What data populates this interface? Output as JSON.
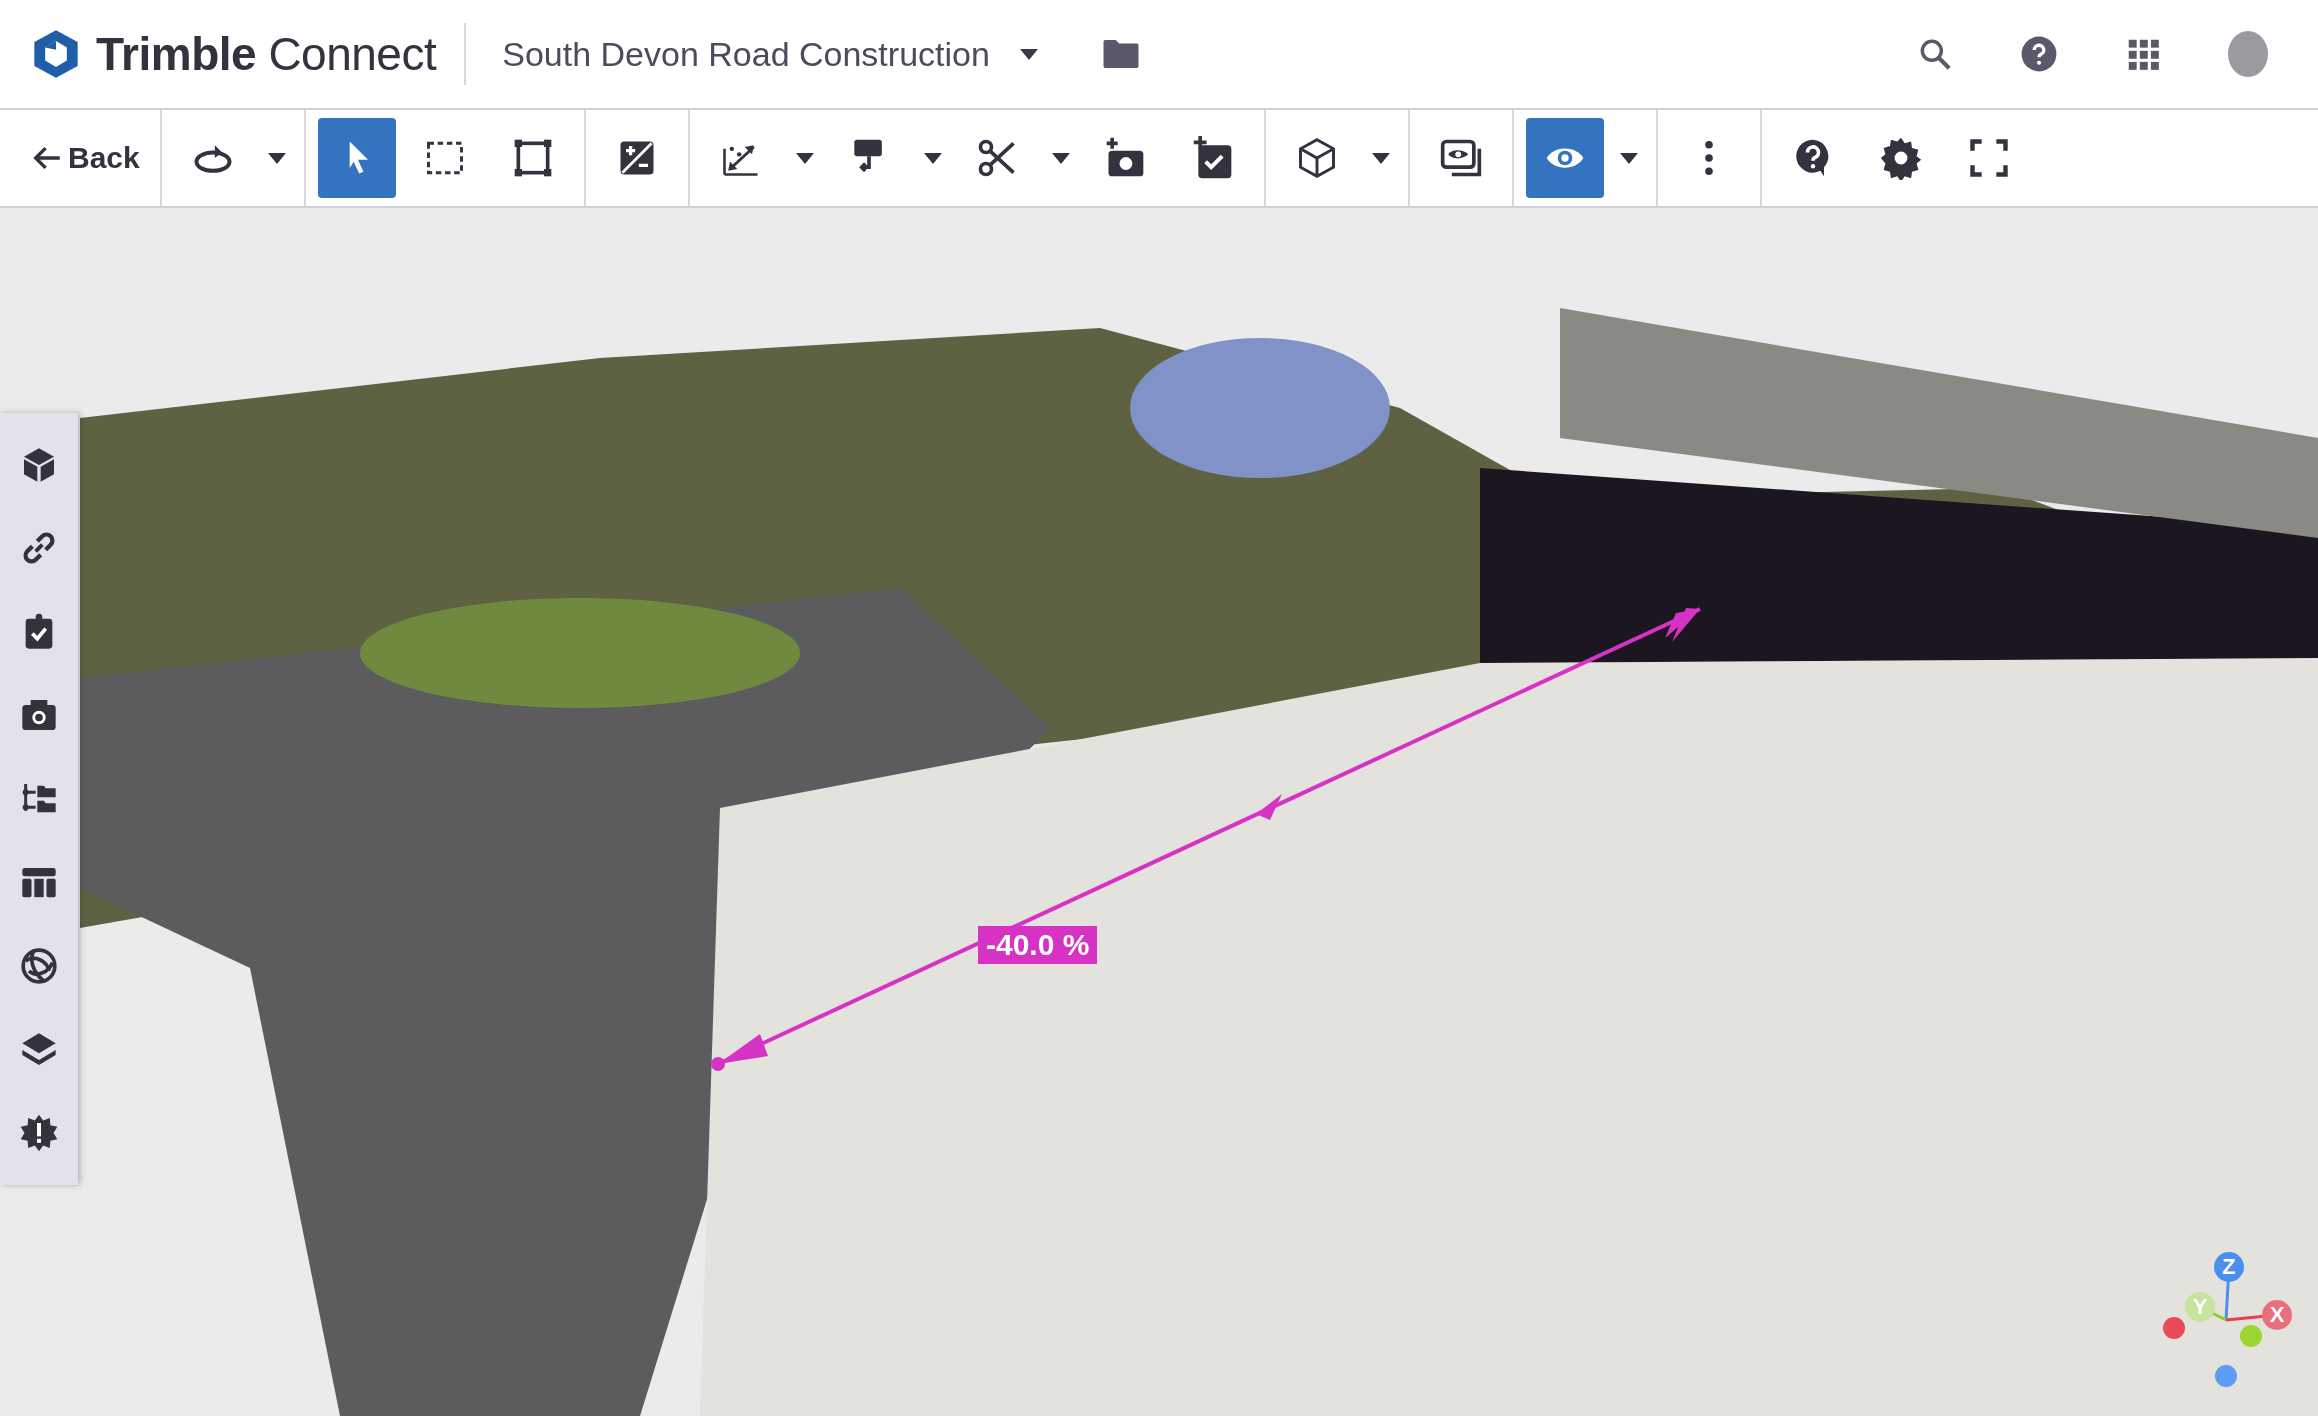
{
  "header": {
    "logo": "**Trimble** Connect",
    "project": "South Devon Road Construction"
  },
  "toolbar": {
    "back": "Back",
    "groups": [
      [
        {
          "selected": false,
          "menu": true
        }
      ],
      [
        {
          "selected": true
        },
        {
          "selected": false
        },
        {
          "selected": false
        }
      ],
      [
        {
          "selected": false
        }
      ],
      [
        {
          "selected": false,
          "menu": true
        },
        {
          "selected": false,
          "menu": true
        },
        {
          "selected": false,
          "menu": true
        },
        {
          "selected": false
        },
        {
          "selected": false
        }
      ],
      [
        {
          "selected": false,
          "menu": true
        }
      ],
      [
        {
          "selected": false
        }
      ],
      [
        {
          "selected": true,
          "menu": true
        }
      ],
      [
        {
          "selected": false
        }
      ],
      [
        {
          "selected": false
        },
        {
          "selected": false
        },
        {
          "selected": false
        }
      ]
    ]
  },
  "measurement": {
    "label": "-40.0 %"
  },
  "axes": [
    {
      "label": "Z"
    },
    {
      "label": "Y"
    },
    {
      "label": "X"
    }
  ]
}
